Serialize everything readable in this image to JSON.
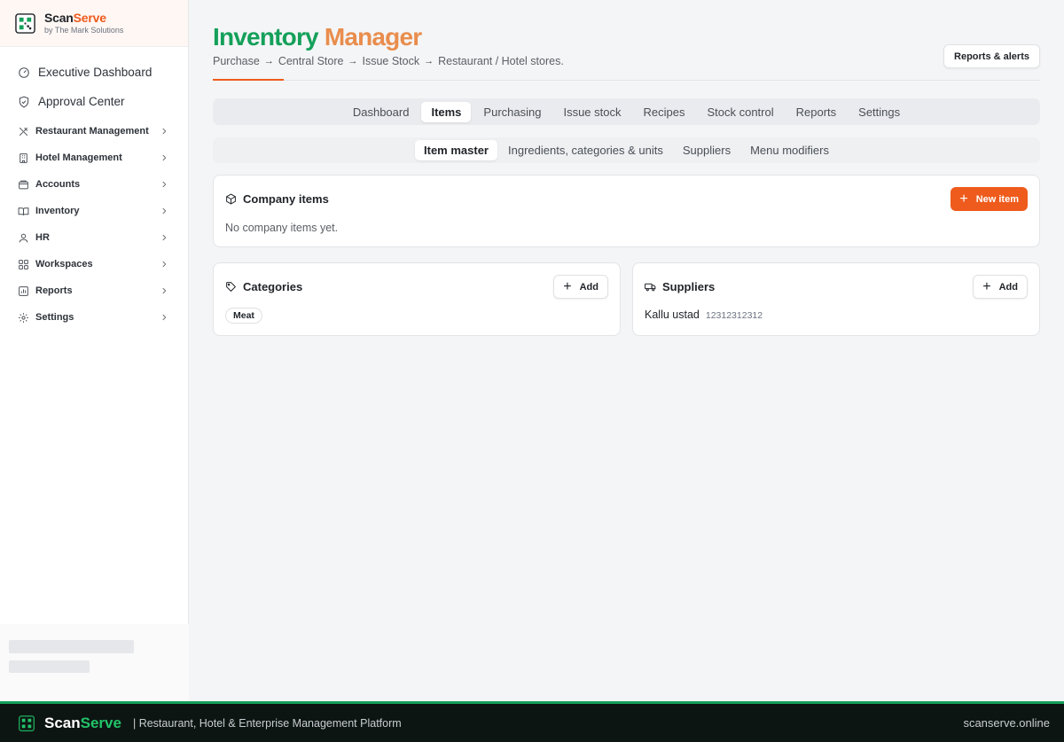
{
  "brand": {
    "name_a": "Scan",
    "name_b": "Serve",
    "sub": "by The Mark Solutions"
  },
  "sidebar": {
    "top_items": [
      {
        "label": "Executive Dashboard",
        "icon": "gauge-icon"
      },
      {
        "label": "Approval Center",
        "icon": "shield-check-icon"
      }
    ],
    "groups": [
      {
        "label": "Restaurant Management",
        "icon": "utensils-icon"
      },
      {
        "label": "Hotel Management",
        "icon": "building-icon"
      },
      {
        "label": "Accounts",
        "icon": "wallet-icon"
      },
      {
        "label": "Inventory",
        "icon": "book-icon"
      },
      {
        "label": "HR",
        "icon": "users-icon"
      },
      {
        "label": "Workspaces",
        "icon": "grid-icon"
      },
      {
        "label": "Reports",
        "icon": "chart-icon"
      },
      {
        "label": "Settings",
        "icon": "gear-icon"
      }
    ]
  },
  "header": {
    "title_a": "Inventory",
    "title_b": "Manager",
    "flow": [
      "Purchase",
      "Central Store",
      "Issue Stock",
      "Restaurant / Hotel stores."
    ],
    "arrow": "→",
    "reports_button": "Reports & alerts"
  },
  "tabs": {
    "items": [
      "Dashboard",
      "Items",
      "Purchasing",
      "Issue stock",
      "Recipes",
      "Stock control",
      "Reports",
      "Settings"
    ],
    "active": "Items"
  },
  "subtabs": {
    "items": [
      "Item master",
      "Ingredients, categories & units",
      "Suppliers",
      "Menu modifiers"
    ],
    "active": "Item master"
  },
  "company_items": {
    "title": "Company items",
    "new_button": "New item",
    "empty_text": "No company items yet."
  },
  "categories": {
    "title": "Categories",
    "add_button": "Add",
    "chips": [
      "Meat"
    ]
  },
  "suppliers": {
    "title": "Suppliers",
    "add_button": "Add",
    "rows": [
      {
        "name": "Kallu ustad",
        "phone": "12312312312"
      }
    ]
  },
  "footer": {
    "brand_a": "Scan",
    "brand_b": "Serve",
    "tagline": "|  Restaurant, Hotel & Enterprise Management Platform",
    "url": "scanserve.online"
  },
  "colors": {
    "accent": "#ee5b1c",
    "brand_green": "#14a05a",
    "footer_bg": "#0d1512"
  }
}
